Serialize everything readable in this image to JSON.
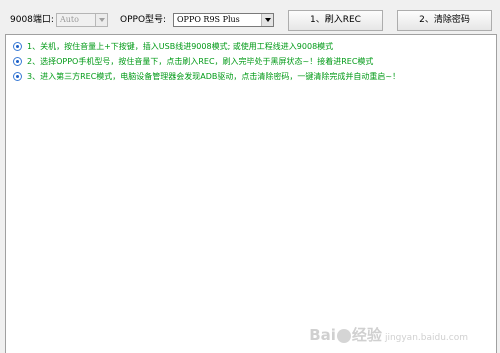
{
  "toolbar": {
    "port_label": "9008端口:",
    "port_value": "Auto",
    "model_label": "OPPO型号:",
    "model_value": "OPPO R9S Plus",
    "rec_button": "1、刷入REC",
    "clear_button": "2、清除密码"
  },
  "instructions": [
    {
      "text": "1、关机，按住音量上+下按键，插入USB线进9008模式;  或使用工程线进入9008模式"
    },
    {
      "text": "2、选择OPPO手机型号，按住音量下，点击刷入REC，刷入完毕处于黑屏状态~！接着进REC模式"
    },
    {
      "text": "3、进入第三方REC模式，电脑设备管理器会发现ADB驱动，点击清除密码，一键清除完成并自动重启~！"
    }
  ],
  "watermark": {
    "brand_left": "Bai",
    "brand_right": "经验",
    "sub": "jingyan.baidu.com"
  },
  "colors": {
    "instruction_text": "#009a16",
    "radio_accent": "#1c5fc8",
    "window_bg": "#f0f0f0"
  }
}
